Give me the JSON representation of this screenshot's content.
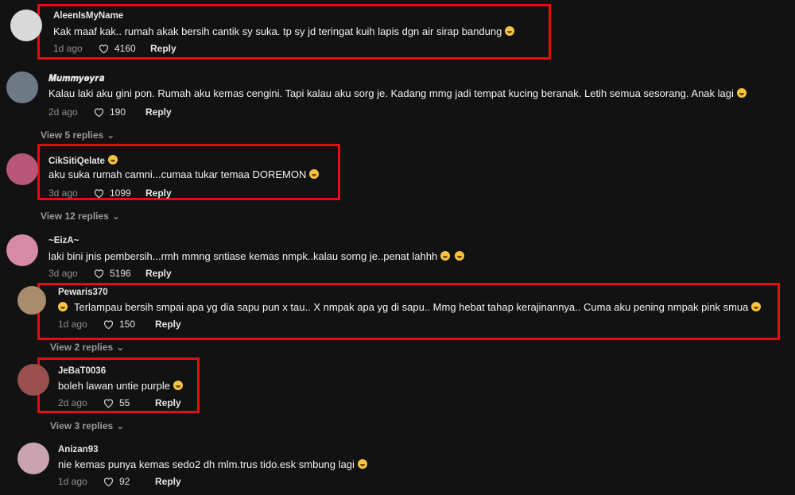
{
  "comments": [
    {
      "user": "AleenIsMyName",
      "text": "Kak maaf kak.. rumah akak bersih cantik sy suka. tp sy jd teringat kuih lapis dgn air sirap bandung",
      "date": "1d ago",
      "likes": "4160",
      "reply": "Reply",
      "avatar_color": "#d9d9d9"
    },
    {
      "user": "𝑴𝒖𝒎𝒎𝒚𝒆𝒚𝒓𝒂",
      "text": "Kalau laki aku gini pon. Rumah aku kemas cengini. Tapi kalau aku sorg je. Kadang mmg jadi tempat kucing beranak. Letih semua sesorang. Anak lagi",
      "date": "2d ago",
      "likes": "190",
      "reply": "Reply",
      "avatar_color": "#6d7a86",
      "view_replies": "View 5 replies"
    },
    {
      "user": "CikSitiQelate",
      "text": "aku suka rumah camni...cumaa tukar temaa DOREMON",
      "date": "3d ago",
      "likes": "1099",
      "reply": "Reply",
      "avatar_color": "#b8577a",
      "view_replies": "View 12 replies"
    },
    {
      "user": "~EizA~",
      "text": "laki bini jnis pembersih...rmh mmng sntiase kemas nmpk..kalau sorng je..penat lahhh",
      "date": "3d ago",
      "likes": "5196",
      "reply": "Reply",
      "avatar_color": "#d58aa8"
    },
    {
      "user": "Pewaris370",
      "text": "Terlampau bersih smpai apa yg dia sapu pun x tau.. X nmpak apa yg di sapu.. Mmg hebat tahap kerajinannya.. Cuma aku pening nmpak pink smua",
      "date": "1d ago",
      "likes": "150",
      "reply": "Reply",
      "avatar_color": "#a88c6e",
      "view_replies": "View 2 replies"
    },
    {
      "user": "JeBaT0036",
      "text": "boleh lawan untie purple",
      "date": "2d ago",
      "likes": "55",
      "reply": "Reply",
      "avatar_color": "#9a4f4f",
      "view_replies": "View 3 replies"
    },
    {
      "user": "Anizan93",
      "text": "nie kemas punya kemas sedo2 dh mlm.trus tido.esk smbung lagi",
      "date": "1d ago",
      "likes": "92",
      "reply": "Reply",
      "avatar_color": "#c9a3b0"
    }
  ],
  "colors": {
    "background": "#121212",
    "highlight": "#e01010"
  }
}
